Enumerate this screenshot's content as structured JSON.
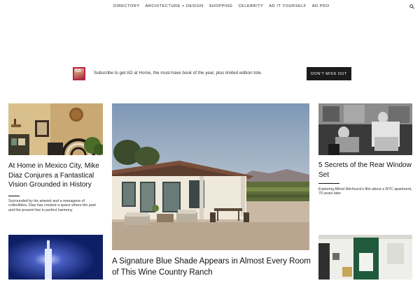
{
  "nav": {
    "items": [
      "Directory",
      "Architecture + Design",
      "Shopping",
      "Celebrity",
      "AD It Yourself",
      "AD PRO"
    ],
    "search_icon": "search-icon"
  },
  "promo": {
    "text": "Subscribe to get AD at Home, the must-have book of the year, plus limited edition tote.",
    "button": "Don't Miss Out",
    "cover_mark": "AD"
  },
  "cards": {
    "left": {
      "title": "At Home in Mexico City, Mike Diaz Conjures a Fantastical Vision Grounded in History",
      "subtitle": "Surrounded by his artwork and a menagerie of collectibles, Diaz has created a space where the past and the present live in perfect harmony"
    },
    "center": {
      "title": "A Signature Blue Shade Appears in Almost Every Room of This Wine Country Ranch"
    },
    "right": {
      "title": "5 Secrets of the Rear Window Set",
      "subtitle": "Exploring Alfred Hitchcock's film about a NYC apartment, 70 years later"
    }
  },
  "colors": {
    "accent_cover": "#b8254a",
    "button_bg": "#1b1b1b",
    "text": "#111111"
  }
}
